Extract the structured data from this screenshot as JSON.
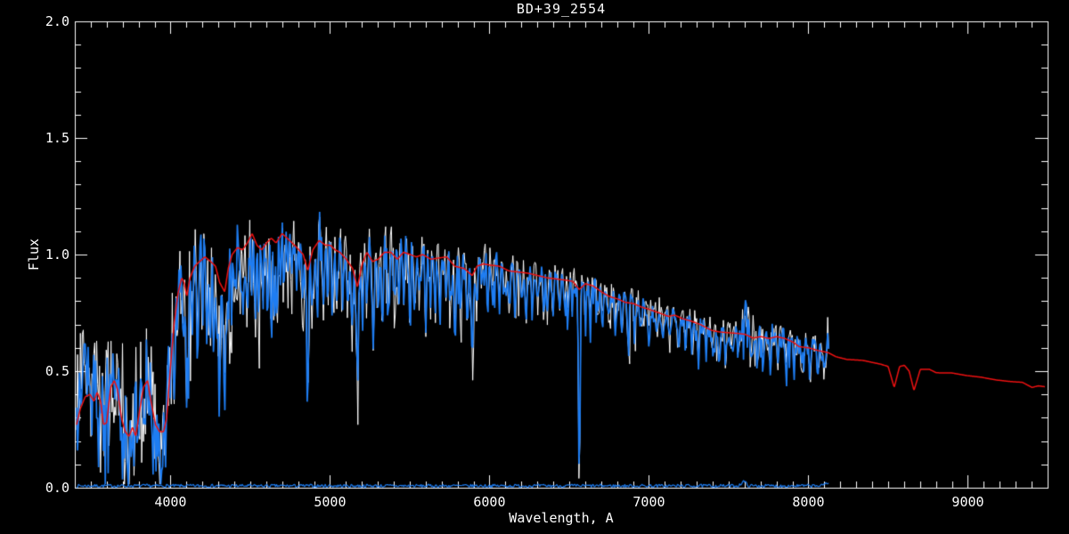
{
  "window": {
    "background": "#000000"
  },
  "chart_data": {
    "type": "line",
    "title": "BD+39_2554",
    "xlabel": "Wavelength, A",
    "ylabel": "Flux",
    "xlim": [
      3400,
      9500
    ],
    "ylim": [
      0.0,
      2.0
    ],
    "x_ticks": [
      4000,
      5000,
      6000,
      7000,
      8000,
      9000
    ],
    "x_minor_step": 100,
    "y_ticks": [
      0.0,
      0.5,
      1.0,
      1.5,
      2.0
    ],
    "y_minor_step": 0.1,
    "grid": false,
    "legend": "none",
    "colors": {
      "background": "#000000",
      "axis": "#ffffff",
      "observed": "#1e7df2",
      "raw": "#ffffff",
      "model": "#ee1111"
    },
    "series_names": [
      "raw-spectrum-white",
      "observed-spectrum-blue",
      "model-spectrum-red",
      "error-spectrum-blue"
    ],
    "observed_range": [
      3411,
      8130
    ],
    "model_range": [
      3411,
      9483
    ],
    "error_level": 0.008,
    "model_continuum": [
      [
        3411,
        0.27
      ],
      [
        3435,
        0.34
      ],
      [
        3465,
        0.39
      ],
      [
        3495,
        0.4
      ],
      [
        3520,
        0.37
      ],
      [
        3540,
        0.41
      ],
      [
        3562,
        0.37
      ],
      [
        3580,
        0.27
      ],
      [
        3600,
        0.28
      ],
      [
        3625,
        0.43
      ],
      [
        3648,
        0.46
      ],
      [
        3668,
        0.42
      ],
      [
        3692,
        0.3
      ],
      [
        3716,
        0.24
      ],
      [
        3740,
        0.22
      ],
      [
        3762,
        0.26
      ],
      [
        3782,
        0.22
      ],
      [
        3806,
        0.33
      ],
      [
        3830,
        0.43
      ],
      [
        3856,
        0.46
      ],
      [
        3880,
        0.36
      ],
      [
        3906,
        0.27
      ],
      [
        3932,
        0.24
      ],
      [
        3956,
        0.24
      ],
      [
        3976,
        0.3
      ],
      [
        4000,
        0.52
      ],
      [
        4022,
        0.7
      ],
      [
        4046,
        0.83
      ],
      [
        4070,
        0.9
      ],
      [
        4086,
        0.88
      ],
      [
        4102,
        0.82
      ],
      [
        4122,
        0.9
      ],
      [
        4152,
        0.95
      ],
      [
        4182,
        0.97
      ],
      [
        4216,
        0.99
      ],
      [
        4252,
        0.97
      ],
      [
        4282,
        0.95
      ],
      [
        4308,
        0.88
      ],
      [
        4340,
        0.84
      ],
      [
        4362,
        0.94
      ],
      [
        4386,
        1.0
      ],
      [
        4420,
        1.03
      ],
      [
        4452,
        1.02
      ],
      [
        4482,
        1.05
      ],
      [
        4512,
        1.09
      ],
      [
        4542,
        1.04
      ],
      [
        4572,
        1.02
      ],
      [
        4602,
        1.05
      ],
      [
        4632,
        1.07
      ],
      [
        4662,
        1.05
      ],
      [
        4700,
        1.09
      ],
      [
        4732,
        1.07
      ],
      [
        4762,
        1.05
      ],
      [
        4792,
        1.03
      ],
      [
        4832,
        1.0
      ],
      [
        4861,
        0.93
      ],
      [
        4892,
        1.02
      ],
      [
        4932,
        1.06
      ],
      [
        4972,
        1.04
      ],
      [
        5002,
        1.04
      ],
      [
        5032,
        1.02
      ],
      [
        5062,
        1.01
      ],
      [
        5102,
        0.98
      ],
      [
        5142,
        0.94
      ],
      [
        5172,
        0.86
      ],
      [
        5202,
        0.96
      ],
      [
        5232,
        1.01
      ],
      [
        5266,
        0.97
      ],
      [
        5302,
        0.98
      ],
      [
        5342,
        1.01
      ],
      [
        5382,
        1.01
      ],
      [
        5422,
        0.98
      ],
      [
        5462,
        1.01
      ],
      [
        5502,
        1.0
      ],
      [
        5542,
        0.99
      ],
      [
        5582,
        1.0
      ],
      [
        5632,
        0.98
      ],
      [
        5682,
        0.985
      ],
      [
        5732,
        0.99
      ],
      [
        5782,
        0.95
      ],
      [
        5842,
        0.94
      ],
      [
        5892,
        0.91
      ],
      [
        5922,
        0.95
      ],
      [
        5962,
        0.96
      ],
      [
        6002,
        0.955
      ],
      [
        6062,
        0.95
      ],
      [
        6122,
        0.93
      ],
      [
        6182,
        0.925
      ],
      [
        6242,
        0.92
      ],
      [
        6302,
        0.91
      ],
      [
        6362,
        0.9
      ],
      [
        6422,
        0.895
      ],
      [
        6482,
        0.89
      ],
      [
        6522,
        0.885
      ],
      [
        6563,
        0.85
      ],
      [
        6602,
        0.875
      ],
      [
        6652,
        0.865
      ],
      [
        6702,
        0.84
      ],
      [
        6752,
        0.82
      ],
      [
        6802,
        0.81
      ],
      [
        6852,
        0.795
      ],
      [
        6902,
        0.79
      ],
      [
        6952,
        0.775
      ],
      [
        7002,
        0.765
      ],
      [
        7062,
        0.75
      ],
      [
        7122,
        0.735
      ],
      [
        7162,
        0.74
      ],
      [
        7212,
        0.725
      ],
      [
        7262,
        0.715
      ],
      [
        7322,
        0.7
      ],
      [
        7392,
        0.675
      ],
      [
        7442,
        0.668
      ],
      [
        7492,
        0.665
      ],
      [
        7552,
        0.662
      ],
      [
        7602,
        0.658
      ],
      [
        7652,
        0.642
      ],
      [
        7702,
        0.648
      ],
      [
        7752,
        0.64
      ],
      [
        7802,
        0.648
      ],
      [
        7852,
        0.64
      ],
      [
        7902,
        0.625
      ],
      [
        7942,
        0.605
      ],
      [
        8002,
        0.6
      ],
      [
        8062,
        0.588
      ],
      [
        8122,
        0.58
      ],
      [
        8172,
        0.562
      ],
      [
        8242,
        0.55
      ],
      [
        8342,
        0.546
      ],
      [
        8396,
        0.538
      ],
      [
        8452,
        0.53
      ],
      [
        8500,
        0.52
      ],
      [
        8538,
        0.43
      ],
      [
        8572,
        0.52
      ],
      [
        8602,
        0.525
      ],
      [
        8632,
        0.5
      ],
      [
        8662,
        0.417
      ],
      [
        8702,
        0.508
      ],
      [
        8758,
        0.508
      ],
      [
        8802,
        0.493
      ],
      [
        8902,
        0.492
      ],
      [
        8992,
        0.481
      ],
      [
        9082,
        0.474
      ],
      [
        9178,
        0.462
      ],
      [
        9272,
        0.455
      ],
      [
        9342,
        0.452
      ],
      [
        9402,
        0.43
      ],
      [
        9442,
        0.437
      ],
      [
        9483,
        0.433
      ]
    ],
    "observed_blue_end_center": [
      [
        3411,
        0.42
      ],
      [
        3450,
        0.46
      ],
      [
        3490,
        0.48
      ],
      [
        3530,
        0.46
      ],
      [
        3560,
        0.44
      ],
      [
        3590,
        0.46
      ],
      [
        3620,
        0.5
      ],
      [
        3650,
        0.52
      ],
      [
        3680,
        0.46
      ],
      [
        3710,
        0.42
      ],
      [
        3740,
        0.4
      ],
      [
        3770,
        0.44
      ],
      [
        3800,
        0.52
      ],
      [
        3830,
        0.56
      ],
      [
        3860,
        0.57
      ],
      [
        3890,
        0.5
      ],
      [
        3920,
        0.48
      ],
      [
        3950,
        0.5
      ],
      [
        3975,
        0.52
      ],
      [
        4000,
        0.62
      ],
      [
        4030,
        0.75
      ],
      [
        4060,
        0.88
      ],
      [
        4090,
        0.88
      ],
      [
        4110,
        0.86
      ]
    ],
    "noise_halfwidth": [
      [
        3411,
        0.16
      ],
      [
        3700,
        0.17
      ],
      [
        3950,
        0.17
      ],
      [
        4050,
        0.14
      ],
      [
        4300,
        0.13
      ],
      [
        4500,
        0.115
      ],
      [
        4800,
        0.105
      ],
      [
        5000,
        0.095
      ],
      [
        5300,
        0.085
      ],
      [
        5600,
        0.075
      ],
      [
        5900,
        0.065
      ],
      [
        6200,
        0.055
      ],
      [
        6500,
        0.05
      ],
      [
        6800,
        0.048
      ],
      [
        7100,
        0.045
      ],
      [
        7400,
        0.042
      ],
      [
        7560,
        0.05
      ],
      [
        7610,
        0.1
      ],
      [
        7690,
        0.05
      ],
      [
        7800,
        0.042
      ],
      [
        8000,
        0.045
      ],
      [
        8130,
        0.05
      ]
    ],
    "absorption_lines": [
      [
        3500,
        0.18,
        6
      ],
      [
        3550,
        0.22,
        6
      ],
      [
        3581,
        0.28,
        6
      ],
      [
        3620,
        0.18,
        5
      ],
      [
        3655,
        0.22,
        6
      ],
      [
        3683,
        0.25,
        6
      ],
      [
        3712,
        0.26,
        6
      ],
      [
        3735,
        0.28,
        6
      ],
      [
        3750,
        0.22,
        5
      ],
      [
        3770,
        0.3,
        6
      ],
      [
        3798,
        0.33,
        7
      ],
      [
        3820,
        0.22,
        5
      ],
      [
        3835,
        0.36,
        6
      ],
      [
        3860,
        0.24,
        5
      ],
      [
        3889,
        0.4,
        7
      ],
      [
        3910,
        0.26,
        5
      ],
      [
        3934,
        0.46,
        8
      ],
      [
        3950,
        0.25,
        5
      ],
      [
        3969,
        0.42,
        8
      ],
      [
        4000,
        0.22,
        5
      ],
      [
        4026,
        0.26,
        5
      ],
      [
        4045,
        0.18,
        5
      ],
      [
        4077,
        0.26,
        5
      ],
      [
        4101,
        0.4,
        8
      ],
      [
        4132,
        0.22,
        5
      ],
      [
        4172,
        0.25,
        5
      ],
      [
        4200,
        0.22,
        5
      ],
      [
        4227,
        0.3,
        6
      ],
      [
        4250,
        0.24,
        5
      ],
      [
        4271,
        0.3,
        5
      ],
      [
        4290,
        0.25,
        5
      ],
      [
        4308,
        0.32,
        6
      ],
      [
        4340,
        0.4,
        7
      ],
      [
        4360,
        0.25,
        5
      ],
      [
        4383,
        0.3,
        5
      ],
      [
        4405,
        0.26,
        5
      ],
      [
        4435,
        0.22,
        5
      ],
      [
        4455,
        0.25,
        5
      ],
      [
        4481,
        0.28,
        5
      ],
      [
        4510,
        0.22,
        5
      ],
      [
        4531,
        0.3,
        5
      ],
      [
        4555,
        0.26,
        5
      ],
      [
        4580,
        0.22,
        5
      ],
      [
        4605,
        0.22,
        5
      ],
      [
        4630,
        0.24,
        5
      ],
      [
        4650,
        0.28,
        5
      ],
      [
        4668,
        0.26,
        5
      ],
      [
        4690,
        0.22,
        5
      ],
      [
        4710,
        0.2,
        5
      ],
      [
        4736,
        0.24,
        5
      ],
      [
        4762,
        0.2,
        5
      ],
      [
        4790,
        0.24,
        5
      ],
      [
        4830,
        0.28,
        5
      ],
      [
        4861,
        0.4,
        7
      ],
      [
        4890,
        0.24,
        5
      ],
      [
        4920,
        0.28,
        5
      ],
      [
        4957,
        0.24,
        5
      ],
      [
        4985,
        0.2,
        5
      ],
      [
        5015,
        0.24,
        5
      ],
      [
        5041,
        0.22,
        5
      ],
      [
        5080,
        0.26,
        5
      ],
      [
        5110,
        0.22,
        5
      ],
      [
        5140,
        0.28,
        5
      ],
      [
        5172,
        0.4,
        7
      ],
      [
        5205,
        0.28,
        5
      ],
      [
        5230,
        0.22,
        5
      ],
      [
        5270,
        0.32,
        6
      ],
      [
        5301,
        0.24,
        5
      ],
      [
        5328,
        0.26,
        5
      ],
      [
        5370,
        0.22,
        5
      ],
      [
        5405,
        0.28,
        5
      ],
      [
        5430,
        0.2,
        5
      ],
      [
        5460,
        0.2,
        5
      ],
      [
        5500,
        0.24,
        5
      ],
      [
        5530,
        0.28,
        5
      ],
      [
        5560,
        0.2,
        5
      ],
      [
        5600,
        0.26,
        5
      ],
      [
        5630,
        0.18,
        5
      ],
      [
        5660,
        0.2,
        5
      ],
      [
        5690,
        0.24,
        5
      ],
      [
        5730,
        0.18,
        5
      ],
      [
        5760,
        0.2,
        5
      ],
      [
        5785,
        0.3,
        6
      ],
      [
        5820,
        0.18,
        5
      ],
      [
        5860,
        0.22,
        5
      ],
      [
        5893,
        0.34,
        7
      ],
      [
        5920,
        0.18,
        5
      ],
      [
        5950,
        0.14,
        5
      ],
      [
        5990,
        0.18,
        5
      ],
      [
        6020,
        0.14,
        5
      ],
      [
        6060,
        0.18,
        5
      ],
      [
        6100,
        0.14,
        5
      ],
      [
        6125,
        0.18,
        5
      ],
      [
        6162,
        0.18,
        5
      ],
      [
        6200,
        0.14,
        5
      ],
      [
        6230,
        0.18,
        5
      ],
      [
        6270,
        0.18,
        5
      ],
      [
        6300,
        0.14,
        5
      ],
      [
        6340,
        0.14,
        5
      ],
      [
        6362,
        0.18,
        5
      ],
      [
        6400,
        0.13,
        5
      ],
      [
        6440,
        0.17,
        5
      ],
      [
        6475,
        0.13,
        5
      ],
      [
        6495,
        0.17,
        5
      ],
      [
        6520,
        0.13,
        5
      ],
      [
        6563,
        0.83,
        5
      ],
      [
        6600,
        0.13,
        5
      ],
      [
        6630,
        0.13,
        5
      ],
      [
        6680,
        0.14,
        5
      ],
      [
        6710,
        0.13,
        5
      ],
      [
        6750,
        0.11,
        5
      ],
      [
        6790,
        0.13,
        5
      ],
      [
        6830,
        0.16,
        5
      ],
      [
        6870,
        0.2,
        6
      ],
      [
        6910,
        0.13,
        5
      ],
      [
        6950,
        0.11,
        5
      ],
      [
        7000,
        0.13,
        5
      ],
      [
        7050,
        0.11,
        5
      ],
      [
        7090,
        0.13,
        5
      ],
      [
        7130,
        0.11,
        5
      ],
      [
        7185,
        0.16,
        6
      ],
      [
        7230,
        0.11,
        5
      ],
      [
        7270,
        0.11,
        5
      ],
      [
        7310,
        0.13,
        5
      ],
      [
        7360,
        0.11,
        5
      ],
      [
        7400,
        0.11,
        5
      ],
      [
        7440,
        0.13,
        5
      ],
      [
        7480,
        0.11,
        5
      ],
      [
        7520,
        0.11,
        5
      ],
      [
        7560,
        0.11,
        5
      ],
      [
        7640,
        0.13,
        5
      ],
      [
        7680,
        0.12,
        5
      ],
      [
        7720,
        0.1,
        5
      ],
      [
        7760,
        0.1,
        5
      ],
      [
        7810,
        0.12,
        5
      ],
      [
        7860,
        0.1,
        5
      ],
      [
        7910,
        0.12,
        5
      ],
      [
        7960,
        0.1,
        5
      ],
      [
        8010,
        0.12,
        5
      ],
      [
        8060,
        0.1,
        5
      ],
      [
        8100,
        0.1,
        5
      ]
    ],
    "emission_spikes": [
      [
        7588,
        0.08,
        3
      ],
      [
        7594,
        0.13,
        4
      ],
      [
        7612,
        0.09,
        4
      ],
      [
        8123,
        0.12,
        3
      ]
    ],
    "error_spike": [
      8115,
      0.015,
      12
    ],
    "error_bump": [
      7594,
      0.018,
      15
    ]
  }
}
